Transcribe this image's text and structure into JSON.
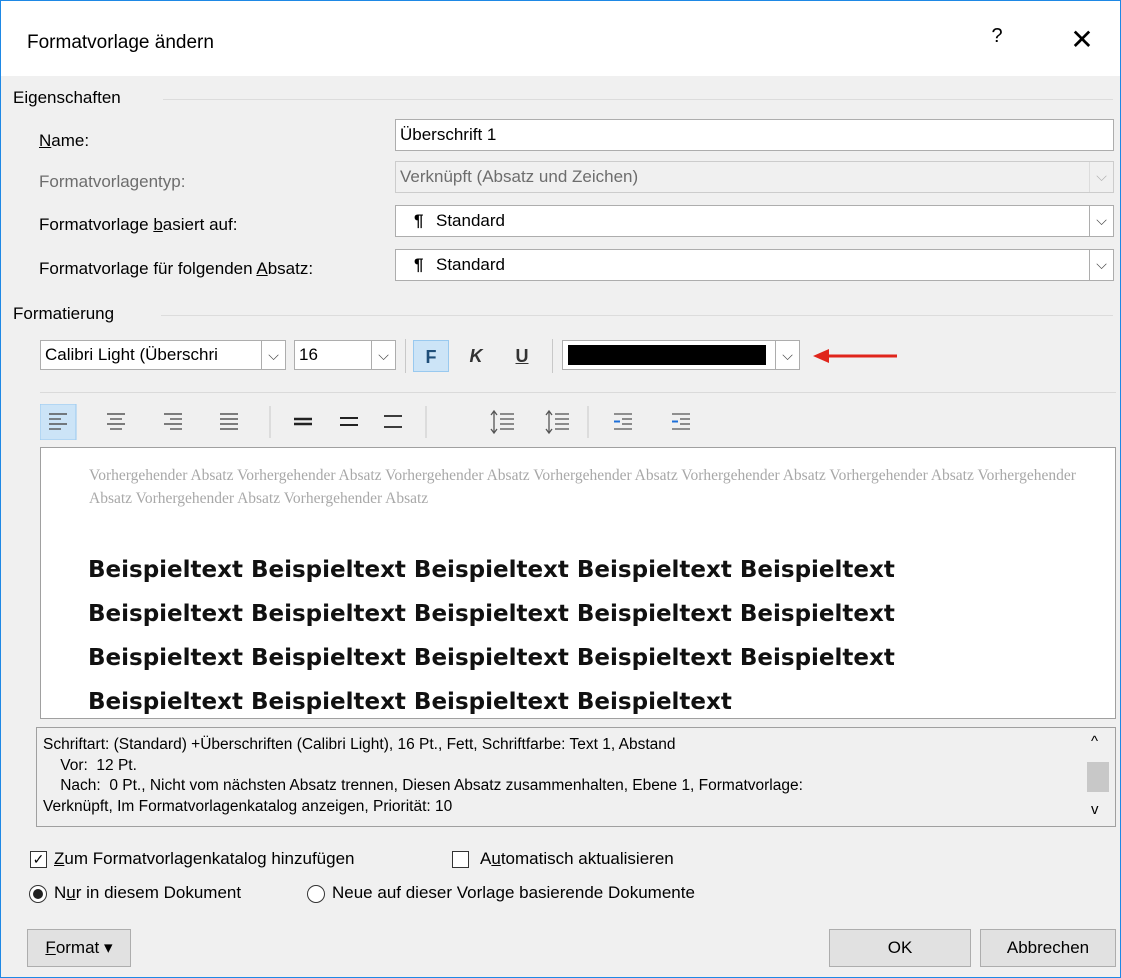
{
  "window": {
    "title": "Formatvorlage ändern",
    "help_glyph": "?",
    "close_glyph": "✕"
  },
  "properties": {
    "group_label": "Eigenschaften",
    "name_label_u": "N",
    "name_label_rest": "ame:",
    "name_value": "Überschrift 1",
    "type_label": "Formatvorlagentyp:",
    "type_value": "Verknüpft (Absatz und Zeichen)",
    "based_on_label_pre": "Formatvorlage ",
    "based_on_label_u": "b",
    "based_on_label_post": "asiert auf:",
    "based_on_value": "Standard",
    "next_label_pre": "Formatvorlage für folgenden ",
    "next_label_u": "A",
    "next_label_post": "bsatz:",
    "next_value": "Standard",
    "pilcrow": "¶",
    "dropdown_glyph": "⌵"
  },
  "formatting": {
    "group_label": "Formatierung",
    "font_value": "Calibri Light (Überschri",
    "size_value": "16",
    "bold_label": "F",
    "italic_label": "K",
    "underline_label": "U",
    "font_color": "#000000",
    "arrow_color": "#e0251b"
  },
  "preview": {
    "previous_paragraph": "Vorhergehender Absatz Vorhergehender Absatz Vorhergehender Absatz Vorhergehender Absatz Vorhergehender Absatz Vorhergehender Absatz Vorhergehender Absatz Vorhergehender Absatz Vorhergehender Absatz",
    "lines": [
      "Beispieltext Beispieltext Beispieltext Beispieltext Beispieltext",
      "Beispieltext Beispieltext Beispieltext Beispieltext Beispieltext",
      "Beispieltext Beispieltext Beispieltext Beispieltext Beispieltext",
      "Beispieltext Beispieltext Beispieltext Beispieltext"
    ]
  },
  "description": {
    "text": "Schriftart: (Standard) +Überschriften (Calibri Light), 16 Pt., Fett, Schriftfarbe: Text 1, Abstand\n    Vor:  12 Pt.\n    Nach:  0 Pt., Nicht vom nächsten Absatz trennen, Diesen Absatz zusammenhalten, Ebene 1, Formatvorlage:\nVerknüpft, Im Formatvorlagenkatalog anzeigen, Priorität: 10",
    "scroll_up": "^",
    "scroll_down": "v"
  },
  "options": {
    "add_to_gallery_u": "Z",
    "add_to_gallery_rest": "um Formatvorlagenkatalog hinzufügen",
    "add_to_gallery_checked": true,
    "auto_update_pre": "A",
    "auto_update_u": "u",
    "auto_update_rest": "tomatisch aktualisieren",
    "auto_update_checked": false,
    "only_doc_pre": "N",
    "only_doc_u": "u",
    "only_doc_rest": "r in diesem Dokument",
    "new_docs_label": "Neue auf dieser Vorlage basierende Dokumente",
    "selected": "only_doc",
    "checkmark": "✓"
  },
  "buttons": {
    "format_u": "F",
    "format_rest": "ormat",
    "format_arrow": "▾",
    "ok": "OK",
    "cancel": "Abbrechen"
  }
}
